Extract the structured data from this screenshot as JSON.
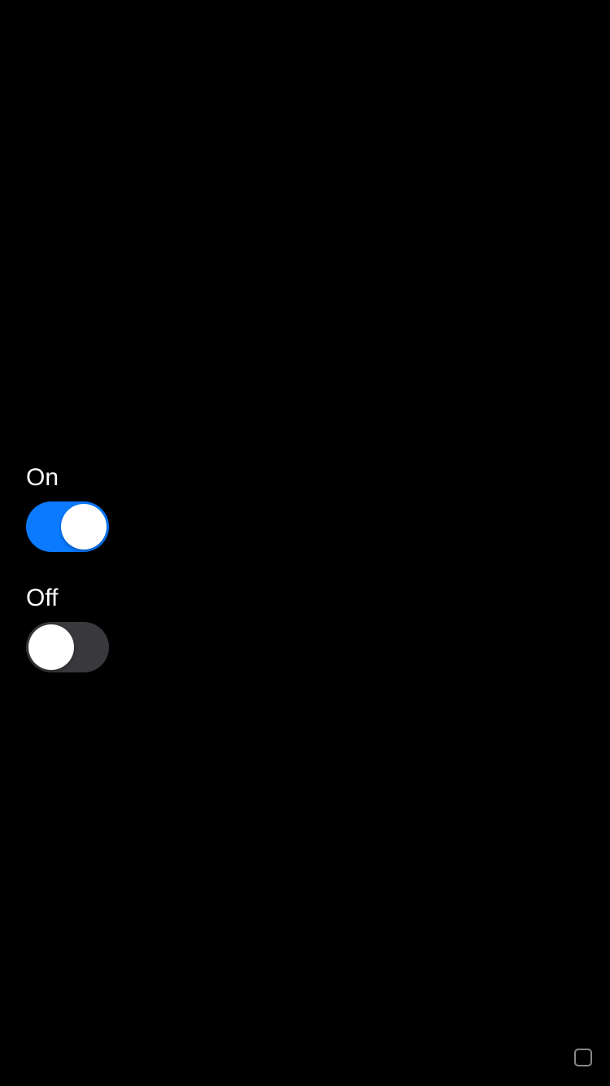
{
  "toggles": [
    {
      "label": "On",
      "state": "on"
    },
    {
      "label": "Off",
      "state": "off"
    }
  ],
  "colors": {
    "background": "#000000",
    "toggle_on": "#0A7AFF",
    "toggle_off": "#39393D",
    "thumb": "#FFFFFF",
    "text": "#FFFFFF"
  }
}
